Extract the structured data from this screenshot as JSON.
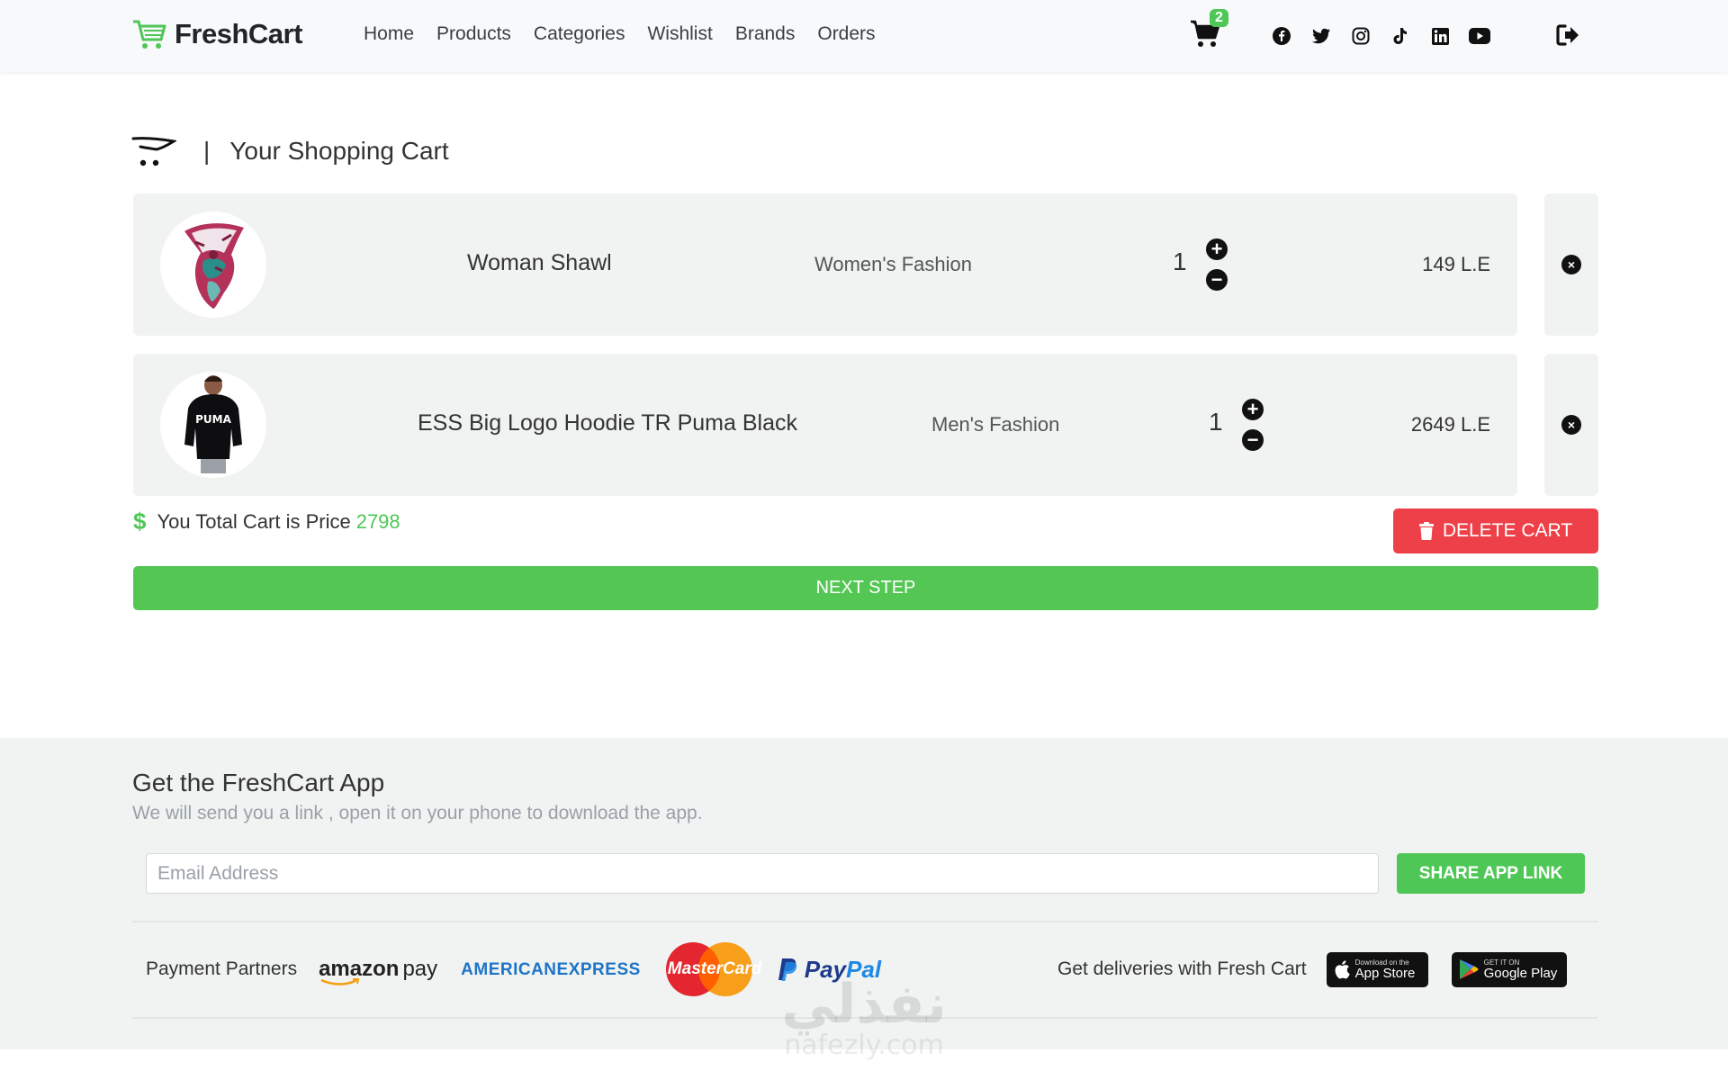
{
  "brand": {
    "name": "FreshCart",
    "color": "#4fc756"
  },
  "nav": {
    "links": [
      "Home",
      "Products",
      "Categories",
      "Wishlist",
      "Brands",
      "Orders"
    ]
  },
  "cart_badge": "2",
  "social_icons": [
    "facebook-icon",
    "twitter-icon",
    "instagram-icon",
    "tiktok-icon",
    "linkedin-icon",
    "youtube-icon"
  ],
  "cart_header": {
    "separator": "|",
    "title": "Your Shopping Cart"
  },
  "items": [
    {
      "name": "Woman Shawl",
      "category": "Women's Fashion",
      "quantity": "1",
      "price": "149 L.E"
    },
    {
      "name": "ESS Big Logo Hoodie TR Puma Black",
      "category": "Men's Fashion",
      "quantity": "1",
      "price": "2649 L.E"
    }
  ],
  "total": {
    "label": "You Total Cart is Price",
    "value": "2798"
  },
  "buttons": {
    "delete_cart": "DELETE CART",
    "next_step": "NEXT STEP",
    "share_app_link": "SHARE APP LINK"
  },
  "footer": {
    "title": "Get the FreshCart App",
    "subtitle": "We will send you a link , open it on your phone to download the app.",
    "email_placeholder": "Email Address",
    "partners_label": "Payment Partners",
    "partners": {
      "amazon": "amazon",
      "amazon_pay": "pay",
      "amex_line1": "AMERICAN",
      "amex_line2": "EXPRESS",
      "mastercard": "MasterCard",
      "paypal_pay": "Pay",
      "paypal_pal": "Pal"
    },
    "deliveries_label": "Get deliveries with Fresh Cart",
    "app_store": {
      "small": "Download on the",
      "big": "App Store"
    },
    "google_play": {
      "small": "GET IT ON",
      "big": "Google Play"
    }
  },
  "watermark": {
    "arabic": "نفذلي",
    "latin": "nafezly.com"
  },
  "colors": {
    "accent": "#4fc756",
    "danger": "#ee4048",
    "panel": "#f0f3f2"
  }
}
